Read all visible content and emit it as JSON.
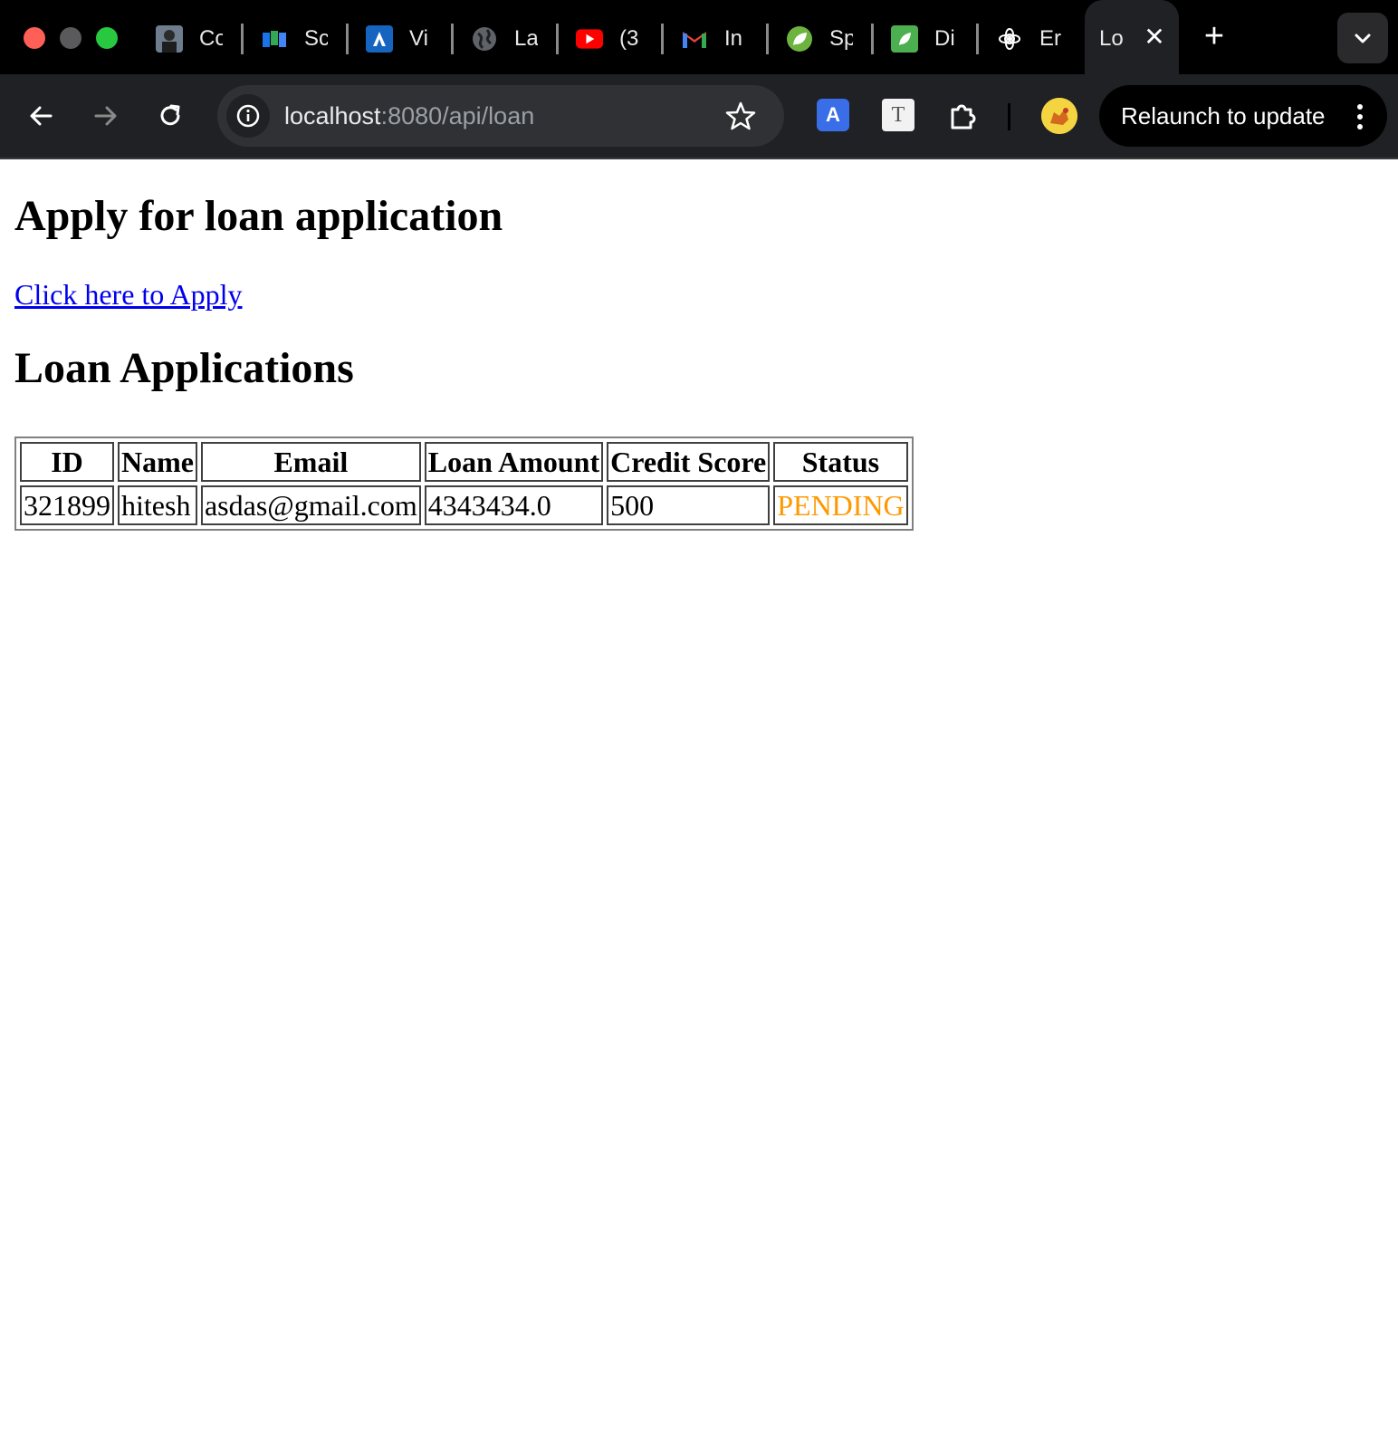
{
  "browser": {
    "tabs": [
      {
        "title": "Co",
        "icon": "profile-photo-icon",
        "color": "#4a5a6a"
      },
      {
        "title": "Sc",
        "icon": "map-icon",
        "color": "#2b7bd6"
      },
      {
        "title": "Vi",
        "icon": "arrow-logo-icon",
        "color": "#1565c0"
      },
      {
        "title": "La",
        "icon": "globe-icon",
        "color": "#5f6368"
      },
      {
        "title": "(3",
        "icon": "youtube-icon",
        "color": "#ff0000"
      },
      {
        "title": "In",
        "icon": "gmail-icon",
        "color": "#ea4335"
      },
      {
        "title": "Sp",
        "icon": "spring-leaf-icon",
        "color": "#6db33f"
      },
      {
        "title": "Di",
        "icon": "leaf-square-icon",
        "color": "#4caf50"
      },
      {
        "title": "Er",
        "icon": "openai-icon",
        "color": "#000000"
      }
    ],
    "active_tab": {
      "title": "Lo",
      "close_glyph": "✕"
    },
    "new_tab_glyph": "+",
    "url_host": "localhost",
    "url_rest": ":8080/api/loan",
    "relaunch_label": "Relaunch to update",
    "translate_glyph": "A",
    "font_ext_glyph": "T"
  },
  "page": {
    "heading": "Apply for loan application",
    "apply_link": "Click here to Apply",
    "table_heading": "Loan Applications",
    "columns": [
      "ID",
      "Name",
      "Email",
      "Loan Amount",
      "Credit Score",
      "Status"
    ],
    "rows": [
      {
        "id": "321899",
        "name": "hitesh",
        "email": "asdas@gmail.com",
        "loan_amount": "4343434.0",
        "credit_score": "500",
        "status": "PENDING"
      }
    ],
    "status_color": "#ff9800",
    "link_color": "#0000ee"
  }
}
